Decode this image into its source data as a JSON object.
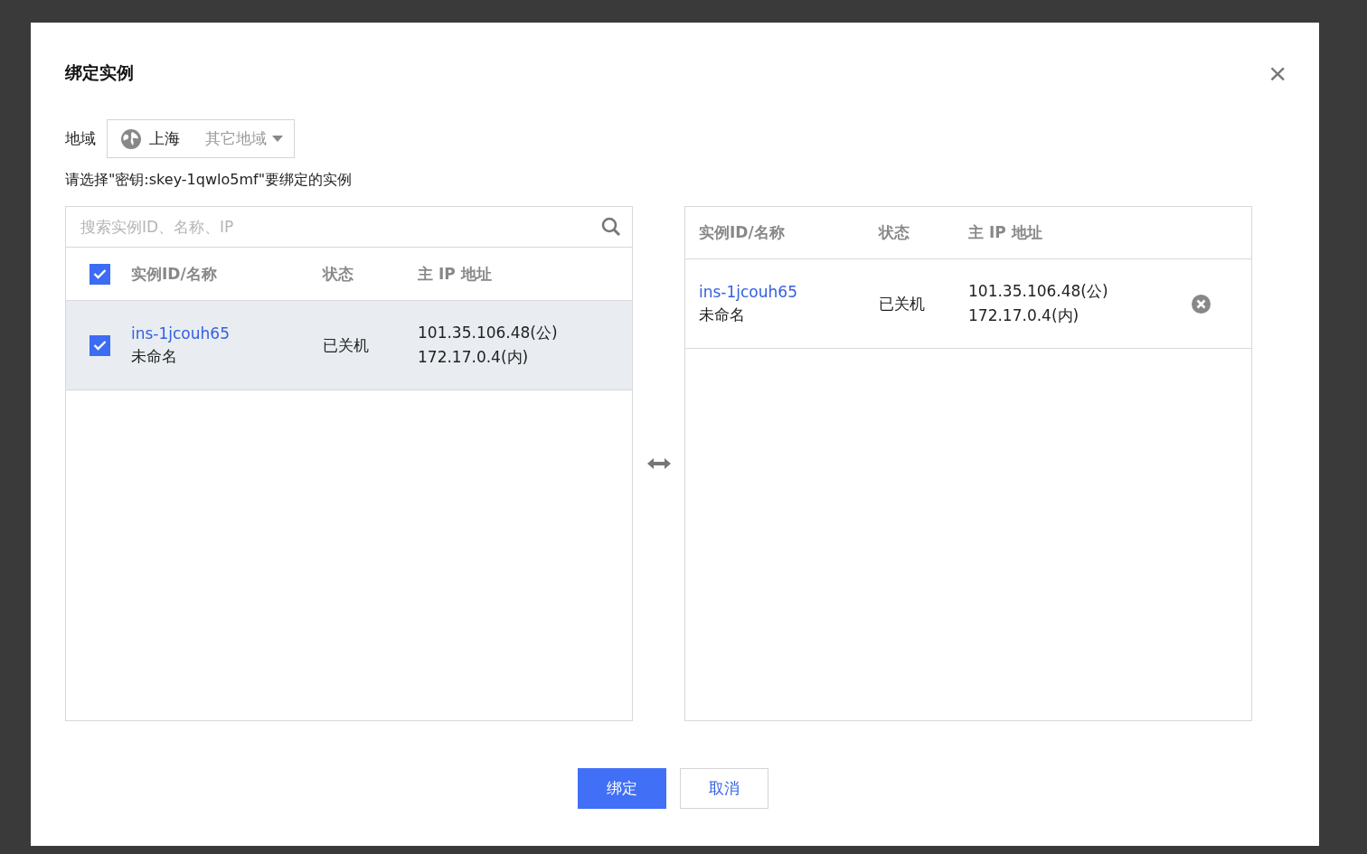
{
  "dialog": {
    "title": "绑定实例",
    "close": "×"
  },
  "region": {
    "label": "地域",
    "current": "上海",
    "other": "其它地域"
  },
  "prompt": "请选择\"密钥:skey-1qwlo5mf\"要绑定的实例",
  "source": {
    "search": {
      "placeholder": "搜索实例ID、名称、IP"
    },
    "all_checked": true,
    "columns": [
      "实例ID/名称",
      "状态",
      "主 IP 地址"
    ],
    "rows": [
      {
        "id": "ins-1jcouh65",
        "name": "未命名",
        "status": "已关机",
        "public_ip": "101.35.106.48(公)",
        "private_ip": "172.17.0.4(内)",
        "checked": true,
        "selected": true
      }
    ]
  },
  "target": {
    "columns": [
      "实例ID/名称",
      "状态",
      "主 IP 地址"
    ],
    "rows": [
      {
        "id": "ins-1jcouh65",
        "name": "未命名",
        "status": "已关机",
        "public_ip": "101.35.106.48(公)",
        "private_ip": "172.17.0.4(内)"
      }
    ]
  },
  "buttons": {
    "confirm": "绑定",
    "cancel": "取消"
  }
}
